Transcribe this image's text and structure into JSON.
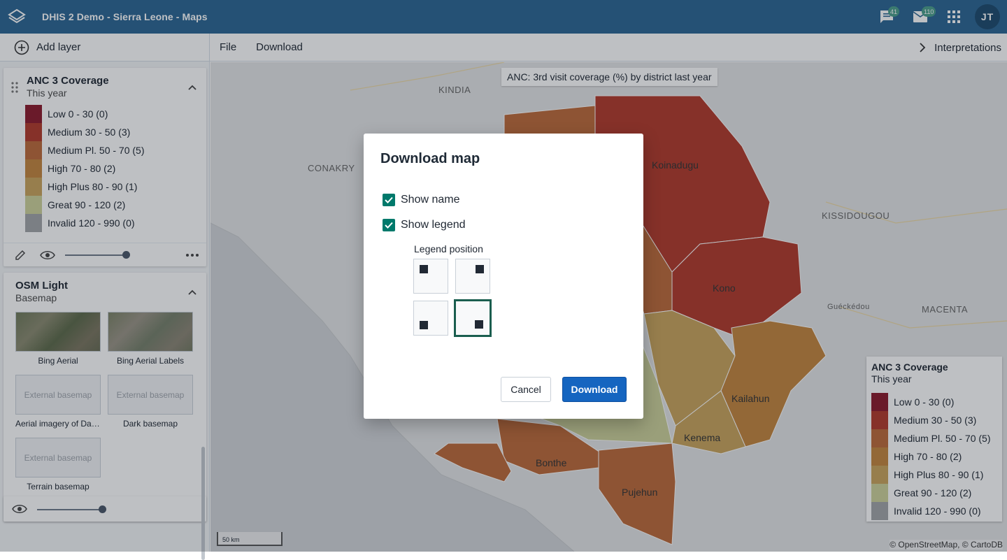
{
  "header": {
    "app_title": "DHIS 2 Demo - Sierra Leone - Maps",
    "messages_count": "41",
    "mail_count": "110",
    "user_initials": "JT"
  },
  "toolbar": {
    "add_layer": "Add layer",
    "file": "File",
    "download": "Download",
    "interpretations": "Interpretations"
  },
  "layers": {
    "thematic": {
      "title": "ANC 3 Coverage",
      "subtitle": "This year",
      "legend": [
        {
          "label": "Low 0 - 30 (0)",
          "color": "#8b1a2b"
        },
        {
          "label": "Medium 30 - 50 (3)",
          "color": "#b23a2a"
        },
        {
          "label": "Medium Pl. 50 - 70 (5)",
          "color": "#bd6a3a"
        },
        {
          "label": "High 70 - 80 (2)",
          "color": "#c4853e"
        },
        {
          "label": "High Plus 80 - 90 (1)",
          "color": "#c9a45c"
        },
        {
          "label": "Great 90 - 120 (2)",
          "color": "#cdd19a"
        },
        {
          "label": "Invalid 120 - 990 (0)",
          "color": "#a3a5a8"
        }
      ]
    },
    "basemap": {
      "title": "OSM Light",
      "subtitle": "Basemap",
      "items": [
        {
          "label": "Bing Aerial"
        },
        {
          "label": "Bing Aerial Labels"
        },
        {
          "label": "Aerial imagery of Dar...",
          "placeholder": "External basemap"
        },
        {
          "label": "Dark basemap",
          "placeholder": "External basemap"
        },
        {
          "label": "Terrain basemap",
          "placeholder": "External basemap"
        }
      ]
    }
  },
  "map": {
    "title": "ANC: 3rd visit coverage (%) by district last year",
    "places": [
      "KINDIA",
      "CONAKRY",
      "KISSIDOUGOU",
      "Guéckédou",
      "MACENTA"
    ],
    "districts": [
      "Koinadugu",
      "Kono",
      "Kailahun",
      "Kenema",
      "Bonthe",
      "Pujehun"
    ],
    "legend_title": "ANC 3 Coverage",
    "legend_subtitle": "This year",
    "scale": "50 km",
    "attribution": "© OpenStreetMap, © CartoDB"
  },
  "dialog": {
    "title": "Download map",
    "show_name": "Show name",
    "show_legend": "Show legend",
    "legend_position_label": "Legend position",
    "selected_position": "bottom-right",
    "cancel": "Cancel",
    "download": "Download"
  }
}
